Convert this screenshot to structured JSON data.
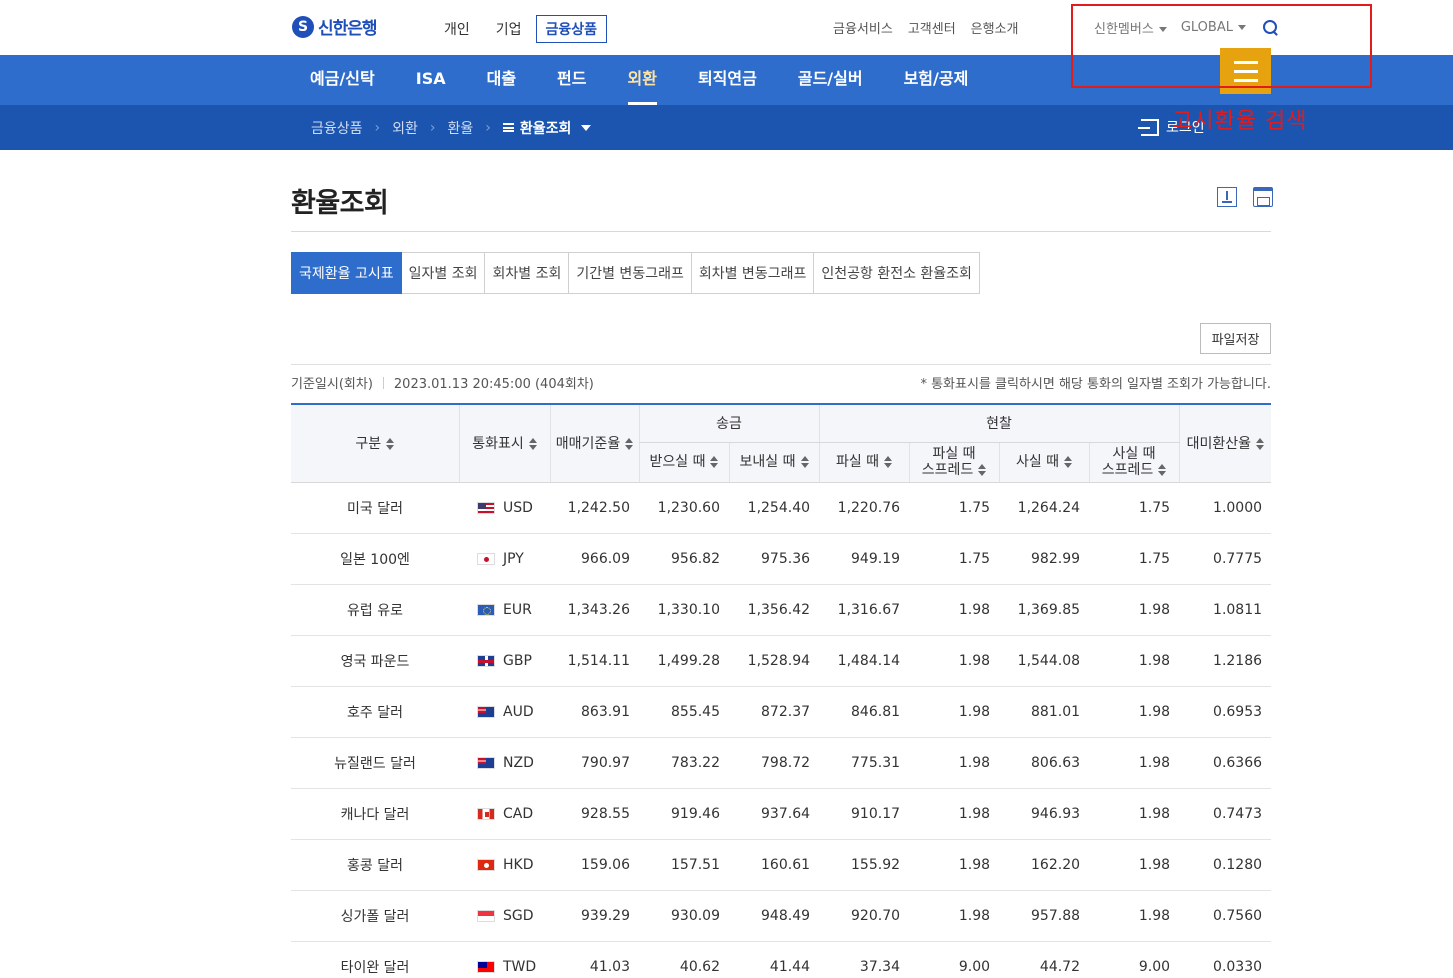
{
  "header": {
    "logo_text": "신한은행",
    "top_nav": [
      "개인",
      "기업",
      "금융상품"
    ],
    "util_nav": [
      "금융서비스",
      "고객센터",
      "은행소개"
    ],
    "members_label": "신한멤버스",
    "global_label": "GLOBAL"
  },
  "main_nav": [
    "예금/신탁",
    "ISA",
    "대출",
    "펀드",
    "외환",
    "퇴직연금",
    "골드/실버",
    "보험/공제"
  ],
  "breadcrumb": {
    "items": [
      "금융상품",
      "외환",
      "환율"
    ],
    "current": "환율조회",
    "login_label": "로그인"
  },
  "annotation": {
    "text": "고시환율 검색",
    "color": "#e21b1b"
  },
  "page": {
    "title": "환율조회"
  },
  "tabs": [
    "국제환율 고시표",
    "일자별 조회",
    "회차별 조회",
    "기간별 변동그래프",
    "회차별 변동그래프",
    "인천공항 환전소 환율조회"
  ],
  "file_button": "파일저장",
  "info": {
    "label": "기준일시(회차)",
    "value": "2023.01.13 20:45:00 (404회차)",
    "note": "* 통화표시를 클릭하시면 해당 통화의 일자별 조회가 가능합니다."
  },
  "table": {
    "headers": {
      "category": "구분",
      "currency": "통화표시",
      "base_rate": "매매기준율",
      "remit_group": "송금",
      "cash_group": "현찰",
      "remit_receive": "받으실 때",
      "remit_send": "보내실 때",
      "cash_sell": "파실 때",
      "cash_sell_spread_1": "파실 때",
      "cash_sell_spread_2": "스프레드",
      "cash_buy": "사실 때",
      "cash_buy_spread_1": "사실 때",
      "cash_buy_spread_2": "스프레드",
      "usd_rate": "대미환산율"
    },
    "rows": [
      {
        "name": "미국 달러",
        "flag": "flag-us",
        "code": "USD",
        "base": "1,242.50",
        "receive": "1,230.60",
        "send": "1,254.40",
        "sell": "1,220.76",
        "sell_spread": "1.75",
        "buy": "1,264.24",
        "buy_spread": "1.75",
        "usd": "1.0000"
      },
      {
        "name": "일본 100엔",
        "flag": "flag-jp",
        "code": "JPY",
        "base": "966.09",
        "receive": "956.82",
        "send": "975.36",
        "sell": "949.19",
        "sell_spread": "1.75",
        "buy": "982.99",
        "buy_spread": "1.75",
        "usd": "0.7775"
      },
      {
        "name": "유럽 유로",
        "flag": "flag-eu",
        "code": "EUR",
        "base": "1,343.26",
        "receive": "1,330.10",
        "send": "1,356.42",
        "sell": "1,316.67",
        "sell_spread": "1.98",
        "buy": "1,369.85",
        "buy_spread": "1.98",
        "usd": "1.0811"
      },
      {
        "name": "영국 파운드",
        "flag": "flag-gb",
        "code": "GBP",
        "base": "1,514.11",
        "receive": "1,499.28",
        "send": "1,528.94",
        "sell": "1,484.14",
        "sell_spread": "1.98",
        "buy": "1,544.08",
        "buy_spread": "1.98",
        "usd": "1.2186"
      },
      {
        "name": "호주 달러",
        "flag": "flag-au",
        "code": "AUD",
        "base": "863.91",
        "receive": "855.45",
        "send": "872.37",
        "sell": "846.81",
        "sell_spread": "1.98",
        "buy": "881.01",
        "buy_spread": "1.98",
        "usd": "0.6953"
      },
      {
        "name": "뉴질랜드 달러",
        "flag": "flag-nz",
        "code": "NZD",
        "base": "790.97",
        "receive": "783.22",
        "send": "798.72",
        "sell": "775.31",
        "sell_spread": "1.98",
        "buy": "806.63",
        "buy_spread": "1.98",
        "usd": "0.6366"
      },
      {
        "name": "캐나다 달러",
        "flag": "flag-ca",
        "code": "CAD",
        "base": "928.55",
        "receive": "919.46",
        "send": "937.64",
        "sell": "910.17",
        "sell_spread": "1.98",
        "buy": "946.93",
        "buy_spread": "1.98",
        "usd": "0.7473"
      },
      {
        "name": "홍콩 달러",
        "flag": "flag-hk",
        "code": "HKD",
        "base": "159.06",
        "receive": "157.51",
        "send": "160.61",
        "sell": "155.92",
        "sell_spread": "1.98",
        "buy": "162.20",
        "buy_spread": "1.98",
        "usd": "0.1280"
      },
      {
        "name": "싱가폴 달러",
        "flag": "flag-sg",
        "code": "SGD",
        "base": "939.29",
        "receive": "930.09",
        "send": "948.49",
        "sell": "920.70",
        "sell_spread": "1.98",
        "buy": "957.88",
        "buy_spread": "1.98",
        "usd": "0.7560"
      },
      {
        "name": "타이완 달러",
        "flag": "flag-tw",
        "code": "TWD",
        "base": "41.03",
        "receive": "40.62",
        "send": "41.44",
        "sell": "37.34",
        "sell_spread": "9.00",
        "buy": "44.72",
        "buy_spread": "9.00",
        "usd": "0.0330"
      }
    ]
  }
}
